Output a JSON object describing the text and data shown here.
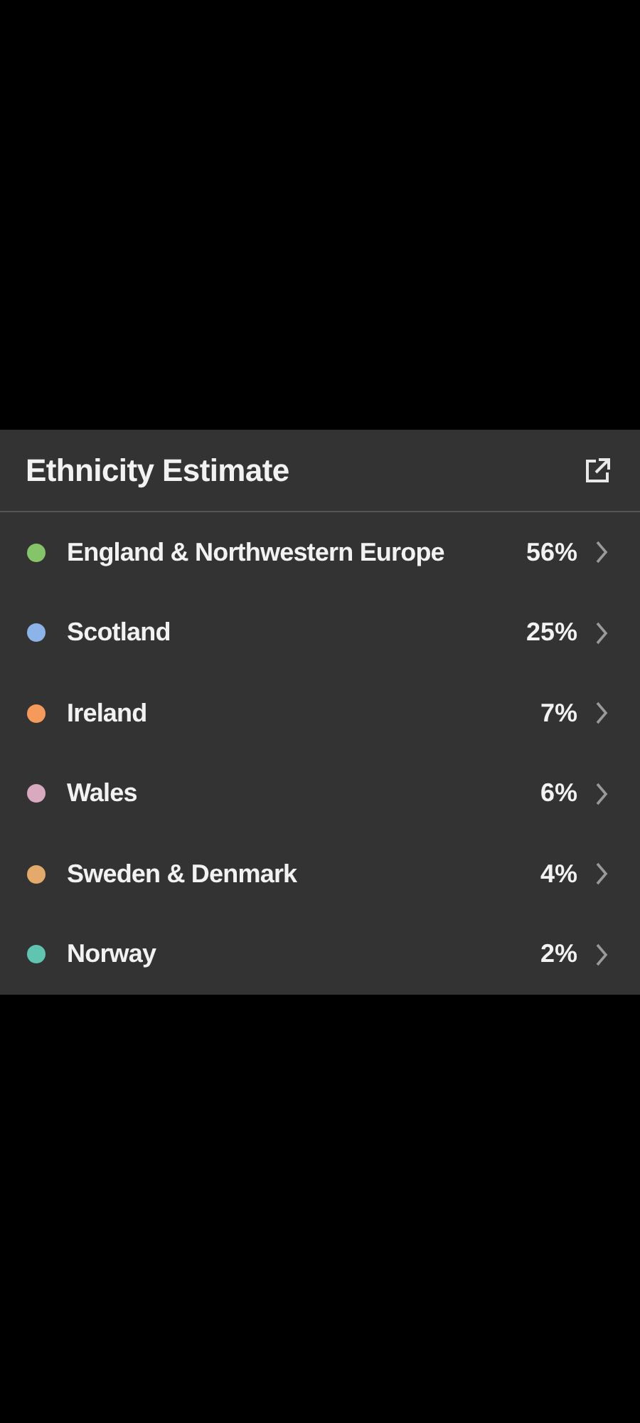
{
  "card": {
    "title": "Ethnicity Estimate",
    "regions": [
      {
        "name": "England & Northwestern Europe",
        "percent": "56%",
        "color": "#86c46a"
      },
      {
        "name": "Scotland",
        "percent": "25%",
        "color": "#8db4e8"
      },
      {
        "name": "Ireland",
        "percent": "7%",
        "color": "#f59a5a"
      },
      {
        "name": "Wales",
        "percent": "6%",
        "color": "#d9a9c0"
      },
      {
        "name": "Sweden & Denmark",
        "percent": "4%",
        "color": "#e3aa6c"
      },
      {
        "name": "Norway",
        "percent": "2%",
        "color": "#5fc4b0"
      }
    ]
  }
}
